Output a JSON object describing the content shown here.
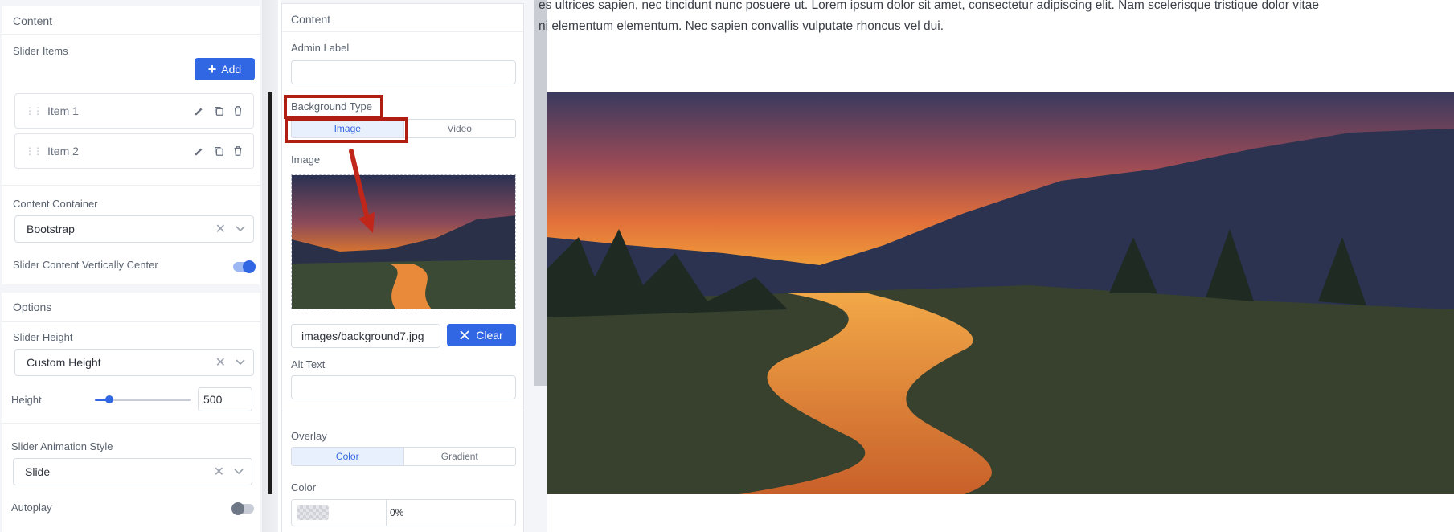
{
  "left_panel": {
    "content_card": {
      "title": "Content",
      "slider_items_label": "Slider Items",
      "add_button": "Add",
      "items": [
        {
          "label": "Item 1"
        },
        {
          "label": "Item 2"
        }
      ],
      "content_container_label": "Content Container",
      "content_container_value": "Bootstrap",
      "vertically_center_label": "Slider Content Vertically Center",
      "vertically_center_on": true
    },
    "options_card": {
      "title": "Options",
      "slider_height_label": "Slider Height",
      "slider_height_value": "Custom Height",
      "height_label": "Height",
      "height_value": "500",
      "height_slider_fraction": 0.15,
      "animation_label": "Slider Animation Style",
      "animation_value": "Slide",
      "autoplay_label": "Autoplay",
      "autoplay_on": false
    }
  },
  "mid_panel": {
    "title": "Content",
    "admin_label": "Admin Label",
    "admin_value": "",
    "background_type_label": "Background Type",
    "background_type_options": [
      "Image",
      "Video"
    ],
    "background_type_selected": "Image",
    "image_label": "Image",
    "image_path": "images/background7.jpg",
    "clear_button": "Clear",
    "alt_text_label": "Alt Text",
    "alt_text_value": "",
    "overlay_label": "Overlay",
    "overlay_options": [
      "Color",
      "Gradient"
    ],
    "overlay_selected": "Color",
    "color_label": "Color",
    "color_opacity": "0%"
  },
  "preview": {
    "line1": "es ultrices sapien, nec tincidunt nunc posuere ut. Lorem ipsum dolor sit amet, consectetur adipiscing elit. Nam scelerisque tristique dolor vitae",
    "line2": "ni elementum elementum. Nec sapien convallis vulputate rhoncus vel dui."
  },
  "colors": {
    "accent": "#3267e3",
    "annotation": "#b01d13"
  }
}
